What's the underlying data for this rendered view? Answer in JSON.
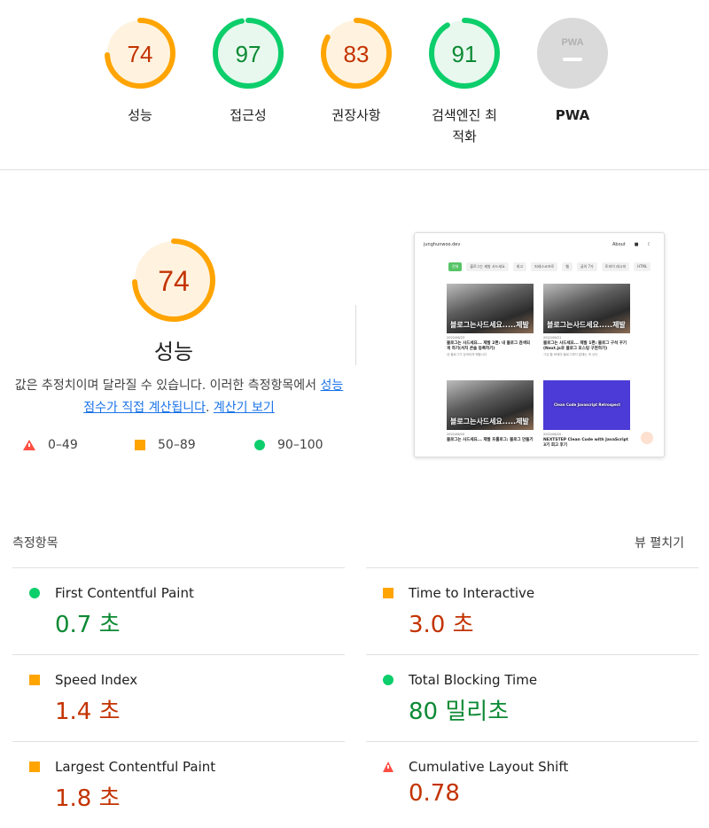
{
  "gauges": [
    {
      "score": "74",
      "label": "성능",
      "status": "average"
    },
    {
      "score": "97",
      "label": "접근성",
      "status": "pass"
    },
    {
      "score": "83",
      "label": "권장사항",
      "status": "average"
    },
    {
      "score": "91",
      "label": "검색엔진 최적화",
      "status": "pass"
    },
    {
      "score": "",
      "label": "PWA",
      "status": "na",
      "badge": "PWA"
    }
  ],
  "performance": {
    "score": "74",
    "fraction": 0.74,
    "title": "성능",
    "desc_text": "값은 추정치이며 달라질 수 있습니다. 이러한 측정항목에서",
    "desc_link": "성능 점수가 직접 계산됩니다",
    "calc_link": "계산기 보기",
    "legend": [
      {
        "range": "0–49",
        "color": "#ff4e42",
        "shape": "triangle"
      },
      {
        "range": "50–89",
        "color": "#ffa400",
        "shape": "square"
      },
      {
        "range": "90–100",
        "color": "#0cce6b",
        "shape": "circle"
      }
    ]
  },
  "screenshot": {
    "site": "junghunwoo.dev",
    "about": "About",
    "nav": [
      "전체",
      "블로그는 제발 사드세요",
      "회고",
      "퍼레스코프로",
      "웹",
      "글의 7가",
      "토피이 레시피",
      "HTML"
    ],
    "cards": [
      {
        "overlay": "블로그는사드세요.....제발",
        "date": "2022/06/23",
        "title": "블로그는 사드세요... 제발 2편: 내 블로그 검색되게 하기(서치 콘솔 등록하기)",
        "sub": "내 블로그가 검색되게 해봅시다"
      },
      {
        "overlay": "블로그는사드세요.....제발",
        "date": "2022/06/21",
        "title": "블로그는 사드세요... 제발 1편: 블로그 구석 꾸기(Next.js로 블로그 포스팅 구현하기)",
        "sub": "그냥 할 바에야 블로그부터 없애는 게 낫다"
      },
      {
        "overlay": "블로그는사드세요.....제발",
        "date": "2022/06/20",
        "title": "블로그는 사드세요... 제발 프롤로그: 블로그 만들기",
        "sub": ""
      },
      {
        "overlay": "Clean Code Javascript Retrospect",
        "date": "2022/06/20",
        "title": "NEXTSTEP Clean Code with JavaScript 3기 회고 후기",
        "sub": ""
      }
    ]
  },
  "metrics_header": "측정항목",
  "expand_label": "뷰 펼치기",
  "metrics": [
    {
      "name": "First Contentful Paint",
      "value": "0.7 초",
      "status": "pass"
    },
    {
      "name": "Time to Interactive",
      "value": "3.0 초",
      "status": "average"
    },
    {
      "name": "Speed Index",
      "value": "1.4 초",
      "status": "average"
    },
    {
      "name": "Total Blocking Time",
      "value": "80 밀리초",
      "status": "pass"
    },
    {
      "name": "Largest Contentful Paint",
      "value": "1.8 초",
      "status": "average"
    },
    {
      "name": "Cumulative Layout Shift",
      "value": "0.78",
      "status": "fail"
    }
  ],
  "colors": {
    "pass": "#0cce6b",
    "average": "#ffa400",
    "fail": "#ff4e42",
    "pass_text": "#0c8a34",
    "avg_text": "#c33300"
  }
}
